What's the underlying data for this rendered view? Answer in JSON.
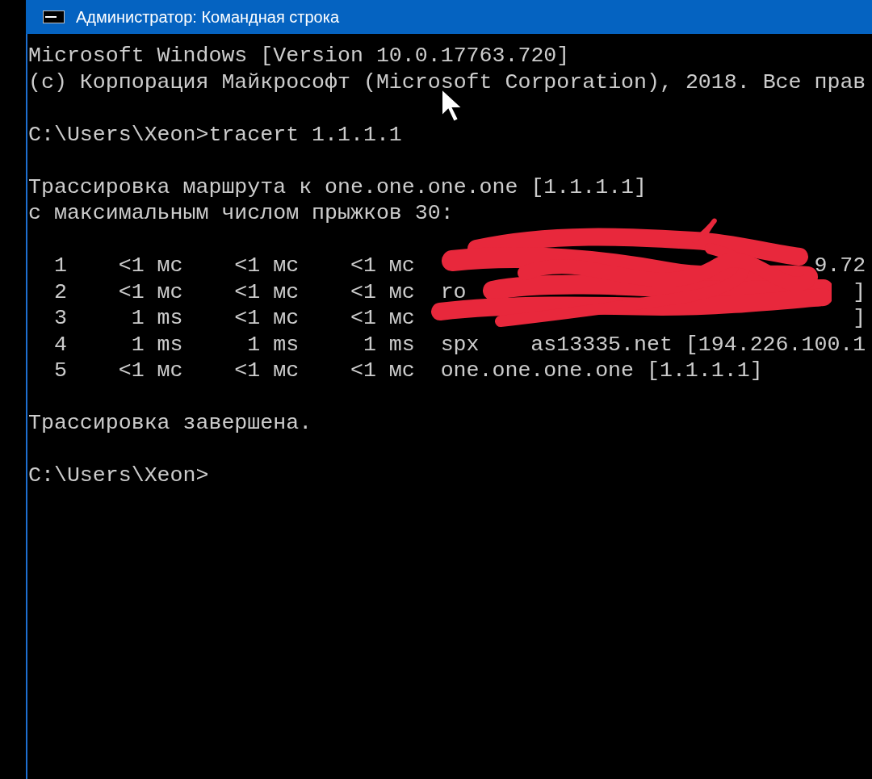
{
  "window": {
    "title": "Администратор: Командная строка"
  },
  "console": {
    "lines": [
      {
        "kind": "text",
        "text": "Microsoft Windows [Version 10.0.17763.720]"
      },
      {
        "kind": "text",
        "text": "(c) Корпорация Майкрософт (Microsoft Corporation), 2018. Все прав"
      },
      {
        "kind": "blank"
      },
      {
        "kind": "text",
        "text": "C:\\Users\\Xeon>tracert 1.1.1.1"
      },
      {
        "kind": "blank"
      },
      {
        "kind": "text",
        "text": "Трассировка маршрута к one.one.one.one [1.1.1.1]"
      },
      {
        "kind": "text",
        "text": "с максимальным числом прыжков 30:"
      },
      {
        "kind": "blank"
      },
      {
        "kind": "hops",
        "hops": [
          {
            "hop": "1",
            "times": [
              "<1 мс",
              "<1 мс",
              "<1 мс"
            ],
            "host": [
              "9.72"
            ]
          },
          {
            "hop": "2",
            "times": [
              "<1 мс",
              "<1 мс",
              "<1 мс"
            ],
            "host": [
              "ro",
              "]"
            ]
          },
          {
            "hop": "3",
            "times": [
              "1 ms",
              "<1 мс",
              "<1 мс"
            ],
            "host": [
              "]"
            ]
          },
          {
            "hop": "4",
            "times": [
              "1 ms",
              "1 ms",
              "1 ms"
            ],
            "host": [
              "spx",
              "as13335.net [194.226.100.1"
            ]
          },
          {
            "hop": "5",
            "times": [
              "<1 мс",
              "<1 мс",
              "<1 мс"
            ],
            "host": [
              "one.one.one.one [1.1.1.1]"
            ]
          }
        ]
      },
      {
        "kind": "blank"
      },
      {
        "kind": "text",
        "text": "Трассировка завершена."
      },
      {
        "kind": "blank"
      },
      {
        "kind": "text",
        "text": "C:\\Users\\Xeon>"
      }
    ]
  }
}
